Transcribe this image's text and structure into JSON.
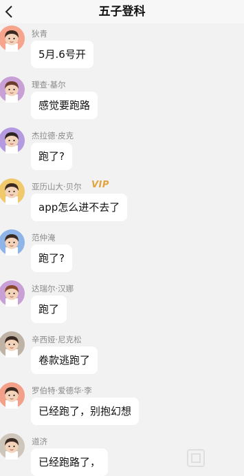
{
  "header": {
    "back_icon": "chevron-left-icon",
    "title": "五子登科"
  },
  "messages": [
    {
      "name": "狄青",
      "text": "5月.6号开",
      "avatar": {
        "skin": "#f4d3bb",
        "hair": "#3b2a22",
        "bg": "#f6a48c"
      }
    },
    {
      "name": "理查·基尔",
      "text": "感觉要跑路",
      "avatar": {
        "skin": "#f4d3bb",
        "hair": "#6b3b2c",
        "bg": "#c9a0d6"
      }
    },
    {
      "name": "杰拉德·皮克",
      "text": "跑了?",
      "avatar": {
        "skin": "#f4d3bb",
        "hair": "#2f2320",
        "bg": "#b49ae0"
      }
    },
    {
      "name": "亚历山大·贝尔",
      "vip": "VIP",
      "text": "app怎么进不去了",
      "avatar": {
        "skin": "#f4d3bb",
        "hair": "#3a2a22",
        "bg": "#f0c96d"
      }
    },
    {
      "name": "范仲淹",
      "text": "跑了?",
      "avatar": {
        "skin": "#f4d3bb",
        "hair": "#3b2a22",
        "bg": "#8fb4e8"
      }
    },
    {
      "name": "达瑞尔·汉娜",
      "text": "跑了",
      "avatar": {
        "skin": "#f4d3bb",
        "hair": "#8a4a2c",
        "bg": "#c9a0d6"
      }
    },
    {
      "name": "辛西娅·尼克松",
      "text": "卷款逃跑了",
      "avatar": {
        "skin": "#f4d3bb",
        "hair": "#3b2a22",
        "bg": "#bfb3a6"
      }
    },
    {
      "name": "罗伯特·爱德华·李",
      "text": "已经跑了，别抱幻想",
      "avatar": {
        "skin": "#f4d3bb",
        "hair": "#3b2a22",
        "bg": "#f2a08a"
      }
    },
    {
      "name": "道济",
      "text": "已经跑路了，",
      "avatar": {
        "skin": "#f4d3bb",
        "hair": "#3b2a22",
        "bg": "#cfc6bb"
      }
    }
  ]
}
